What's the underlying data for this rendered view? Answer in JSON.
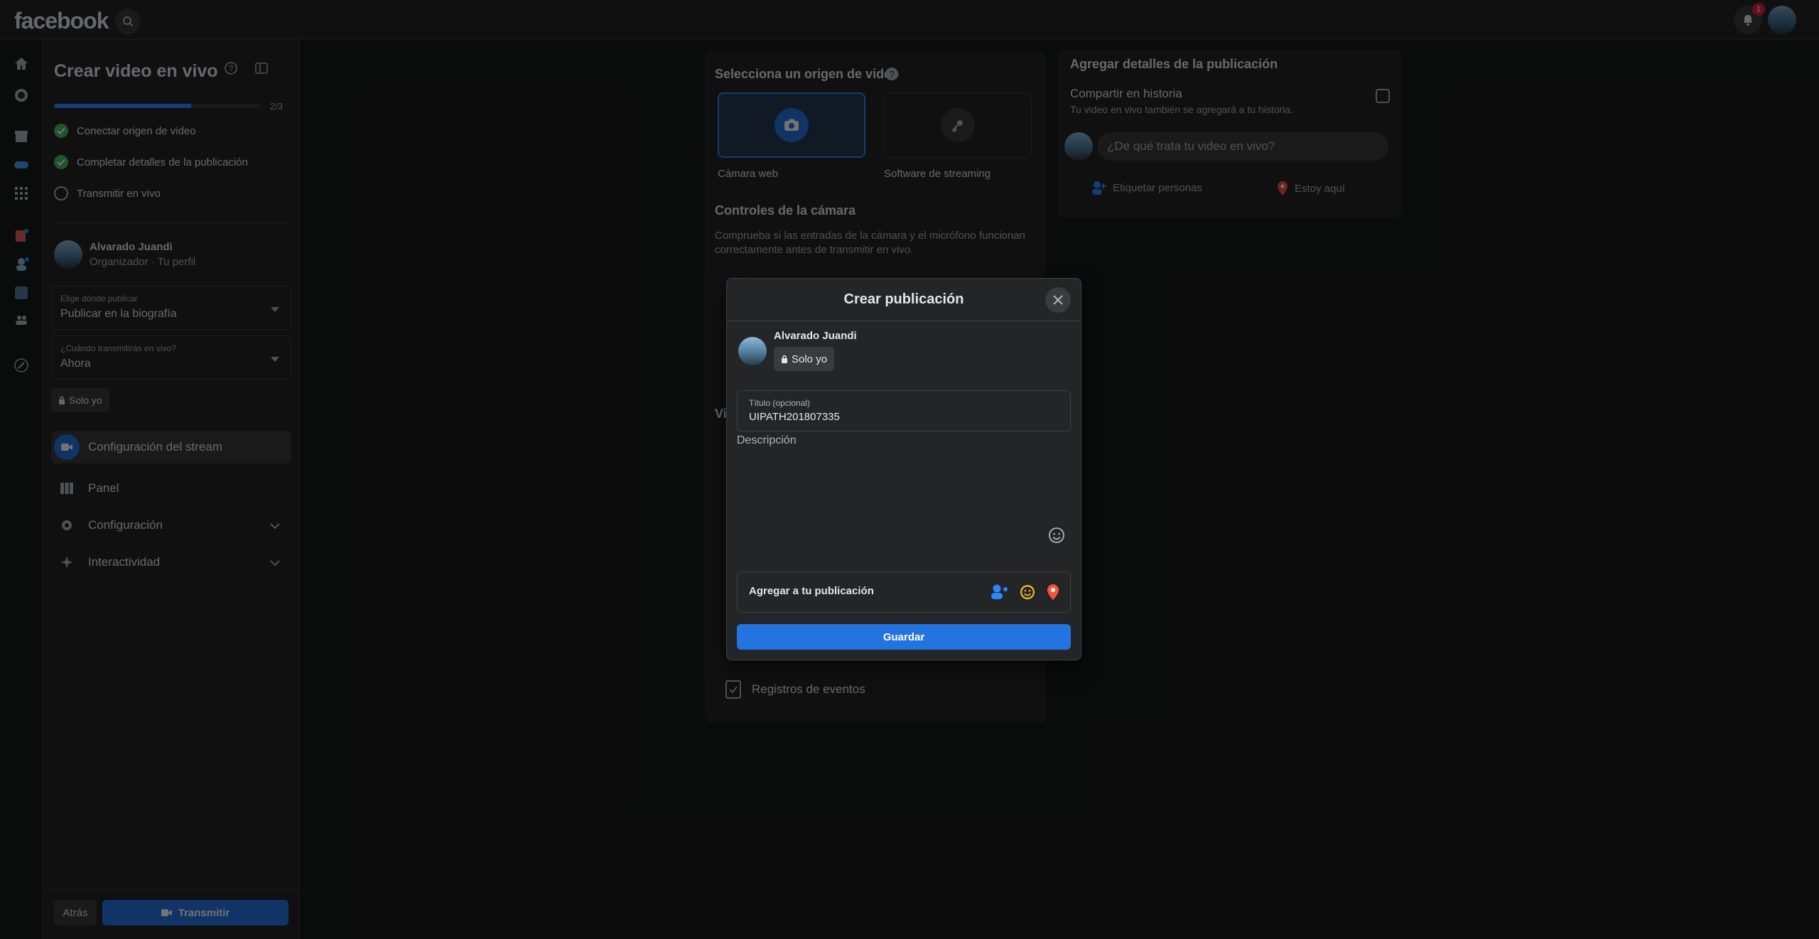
{
  "app": {
    "logo": "facebook",
    "notification_count": "1"
  },
  "sidebar": {
    "title": "Crear video en vivo",
    "progress_text": "2/3",
    "progress_fraction": 0.667,
    "steps": [
      {
        "label": "Conectar origen de video",
        "done": true
      },
      {
        "label": "Completar detalles de la publicación",
        "done": true
      },
      {
        "label": "Transmitir en vivo",
        "done": false
      }
    ],
    "user": {
      "name": "Alvarado Juandi",
      "role": "Organizador · Tu perfil"
    },
    "where_to_post": {
      "label": "Elige dónde publicar",
      "value": "Publicar en la biografía"
    },
    "when": {
      "label": "¿Cuándo transmitirás en vivo?",
      "value": "Ahora"
    },
    "privacy": "Solo yo",
    "nav": [
      {
        "label": "Configuración del stream",
        "active": true
      },
      {
        "label": "Panel",
        "active": false
      },
      {
        "label": "Configuración",
        "active": false
      },
      {
        "label": "Interactividad",
        "active": false
      }
    ],
    "back_label": "Atrás",
    "live_label": "Transmitir"
  },
  "source": {
    "title": "Selecciona un origen de video",
    "options": [
      {
        "label": "Cámara web",
        "selected": true
      },
      {
        "label": "Software de streaming",
        "selected": false
      }
    ]
  },
  "camera": {
    "title": "Controles de la cámara",
    "description_line1": "Comprueba si las entradas de la cámara y el micrófono funcionan",
    "description_line2": "correctamente antes de transmitir en vivo."
  },
  "center_partial": {
    "heading_fragment": "Vi"
  },
  "events_log": {
    "label": "Registros de eventos"
  },
  "details": {
    "title": "Agregar detalles de la publicación",
    "share_story": "Compartir en historia",
    "share_story_sub": "Tu video en vivo también se agregará a tu historia.",
    "placeholder": "¿De qué trata tu video en vivo?",
    "tag_people": "Etiquetar personas",
    "location": "Estoy aquí"
  },
  "modal": {
    "title": "Crear publicación",
    "user_name": "Alvarado Juandi",
    "privacy": "Solo yo",
    "title_label": "Título (opcional)",
    "title_value": "UIPATH201807335",
    "description_label": "Descripción",
    "add_to_post": "Agregar a tu publicación",
    "save_label": "Guardar"
  },
  "colors": {
    "accent": "#2374e1",
    "success": "#45bd62",
    "location": "#f5533d",
    "emoji": "#f7b928"
  }
}
